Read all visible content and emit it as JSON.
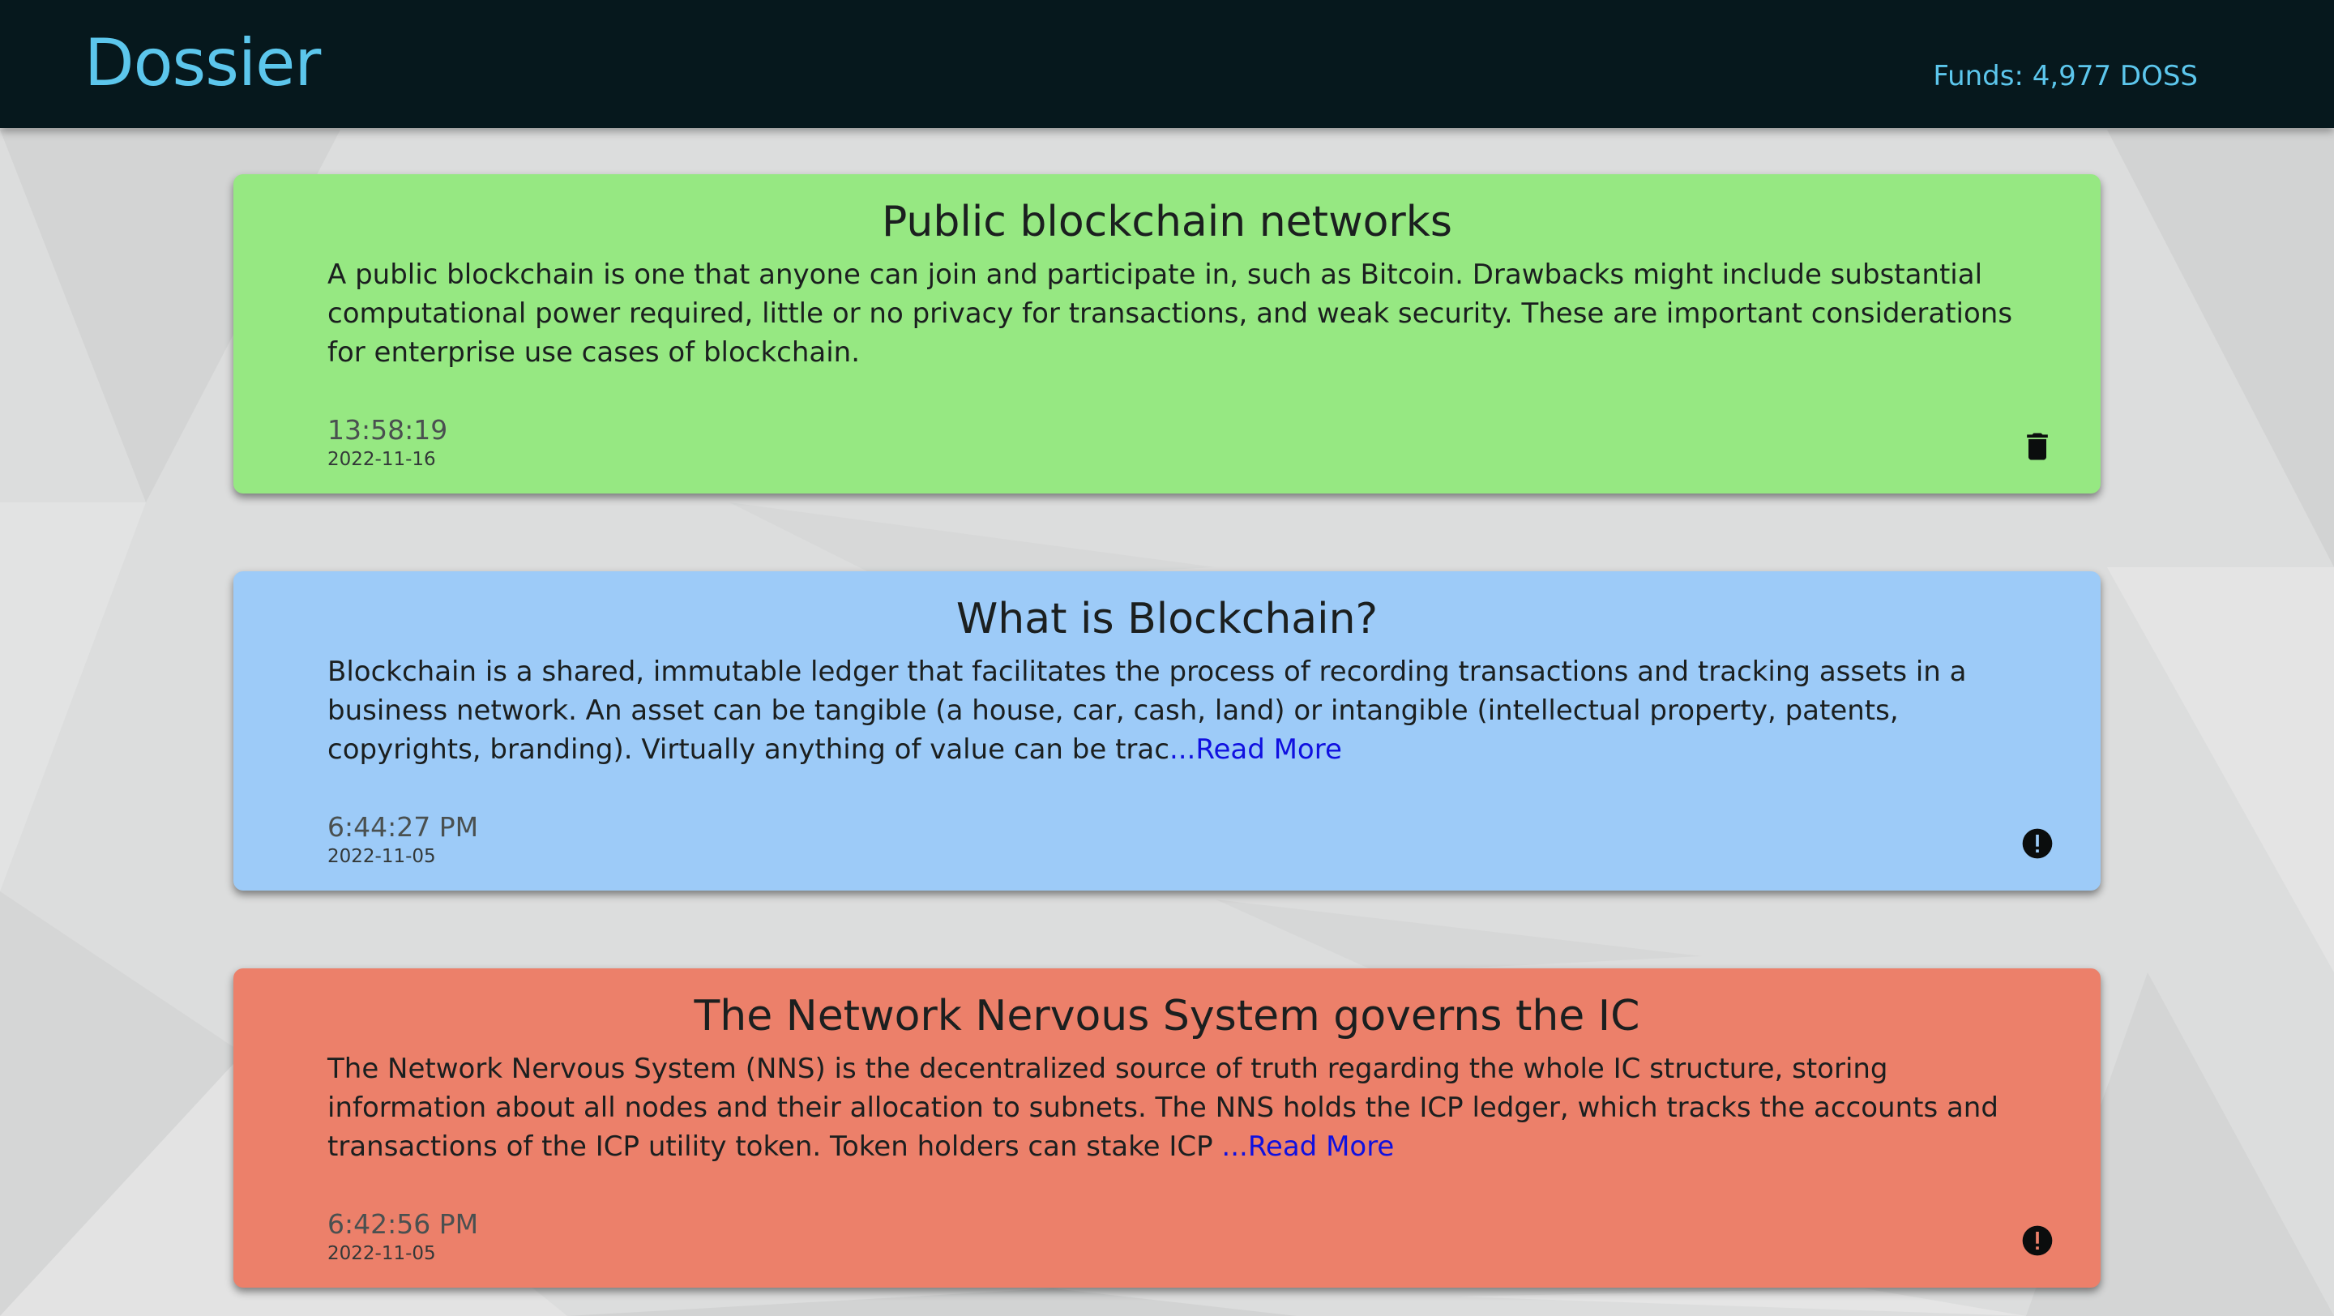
{
  "header": {
    "logo": "Dossier",
    "funds": "Funds: 4,977 DOSS"
  },
  "notes": [
    {
      "title": "Public blockchain networks",
      "body": "A public blockchain is one that anyone can join and participate in, such as Bitcoin. Drawbacks might include substantial computational power required, little or no privacy for transactions, and weak security. These are important considerations for enterprise use cases of blockchain.",
      "read_more": "",
      "time": "13:58:19",
      "date": "2022-11-16",
      "color": "#96e882",
      "icon": "trash-icon"
    },
    {
      "title": "What is Blockchain?",
      "body": "Blockchain is a shared, immutable ledger that facilitates the process of recording transactions and tracking assets in a business network. An asset can be tangible (a house, car, cash, land) or intangible (intellectual property, patents, copyrights, branding). Virtually anything of value can be trac",
      "read_more": "...Read More",
      "time": "6:44:27 PM",
      "date": "2022-11-05",
      "color": "#9dcbf8",
      "icon": "alert-circle-icon"
    },
    {
      "title": "The Network Nervous System governs the IC",
      "body": "The Network Nervous System (NNS) is the decentralized source of truth regarding the whole IC structure, storing information about all nodes and their allocation to subnets. The NNS holds the ICP ledger, which tracks the accounts and transactions of the ICP utility token. Token holders can stake ICP ",
      "read_more": "...Read More",
      "time": "6:42:56 PM",
      "date": "2022-11-05",
      "color": "#ec806a",
      "icon": "alert-circle-icon"
    }
  ]
}
